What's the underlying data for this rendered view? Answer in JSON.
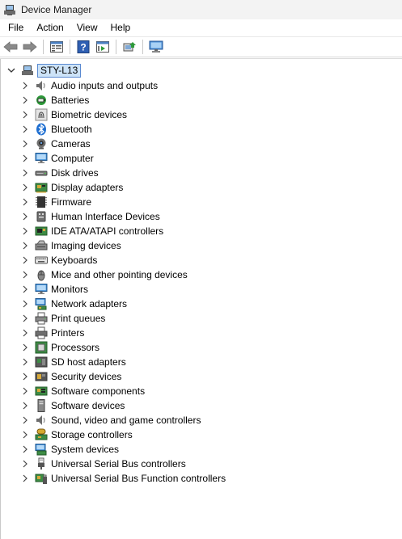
{
  "window": {
    "title": "Device Manager"
  },
  "menu": [
    "File",
    "Action",
    "View",
    "Help"
  ],
  "tree": {
    "root_label": "STY-L13",
    "items": [
      {
        "label": "Audio inputs and outputs",
        "icon": "speaker-icon"
      },
      {
        "label": "Batteries",
        "icon": "battery-icon"
      },
      {
        "label": "Biometric devices",
        "icon": "fingerprint-icon"
      },
      {
        "label": "Bluetooth",
        "icon": "bluetooth-icon"
      },
      {
        "label": "Cameras",
        "icon": "camera-icon"
      },
      {
        "label": "Computer",
        "icon": "computer-icon"
      },
      {
        "label": "Disk drives",
        "icon": "disk-drive-icon"
      },
      {
        "label": "Display adapters",
        "icon": "display-adapter-icon"
      },
      {
        "label": "Firmware",
        "icon": "firmware-icon"
      },
      {
        "label": "Human Interface Devices",
        "icon": "hid-icon"
      },
      {
        "label": "IDE ATA/ATAPI controllers",
        "icon": "ide-controller-icon"
      },
      {
        "label": "Imaging devices",
        "icon": "imaging-device-icon"
      },
      {
        "label": "Keyboards",
        "icon": "keyboard-icon"
      },
      {
        "label": "Mice and other pointing devices",
        "icon": "mouse-icon"
      },
      {
        "label": "Monitors",
        "icon": "monitor-icon"
      },
      {
        "label": "Network adapters",
        "icon": "network-adapter-icon"
      },
      {
        "label": "Print queues",
        "icon": "print-queue-icon"
      },
      {
        "label": "Printers",
        "icon": "printer-icon"
      },
      {
        "label": "Processors",
        "icon": "processor-icon"
      },
      {
        "label": "SD host adapters",
        "icon": "sd-host-icon"
      },
      {
        "label": "Security devices",
        "icon": "security-device-icon"
      },
      {
        "label": "Software components",
        "icon": "software-component-icon"
      },
      {
        "label": "Software devices",
        "icon": "software-device-icon"
      },
      {
        "label": "Sound, video and game controllers",
        "icon": "sound-controller-icon"
      },
      {
        "label": "Storage controllers",
        "icon": "storage-controller-icon"
      },
      {
        "label": "System devices",
        "icon": "system-device-icon"
      },
      {
        "label": "Universal Serial Bus controllers",
        "icon": "usb-icon"
      },
      {
        "label": "Universal Serial Bus Function controllers",
        "icon": "usb-function-icon"
      }
    ]
  },
  "colors": {
    "selection_bg": "#cde3f7",
    "selection_border": "#5a8ad1",
    "accent": "#2b79d6"
  }
}
